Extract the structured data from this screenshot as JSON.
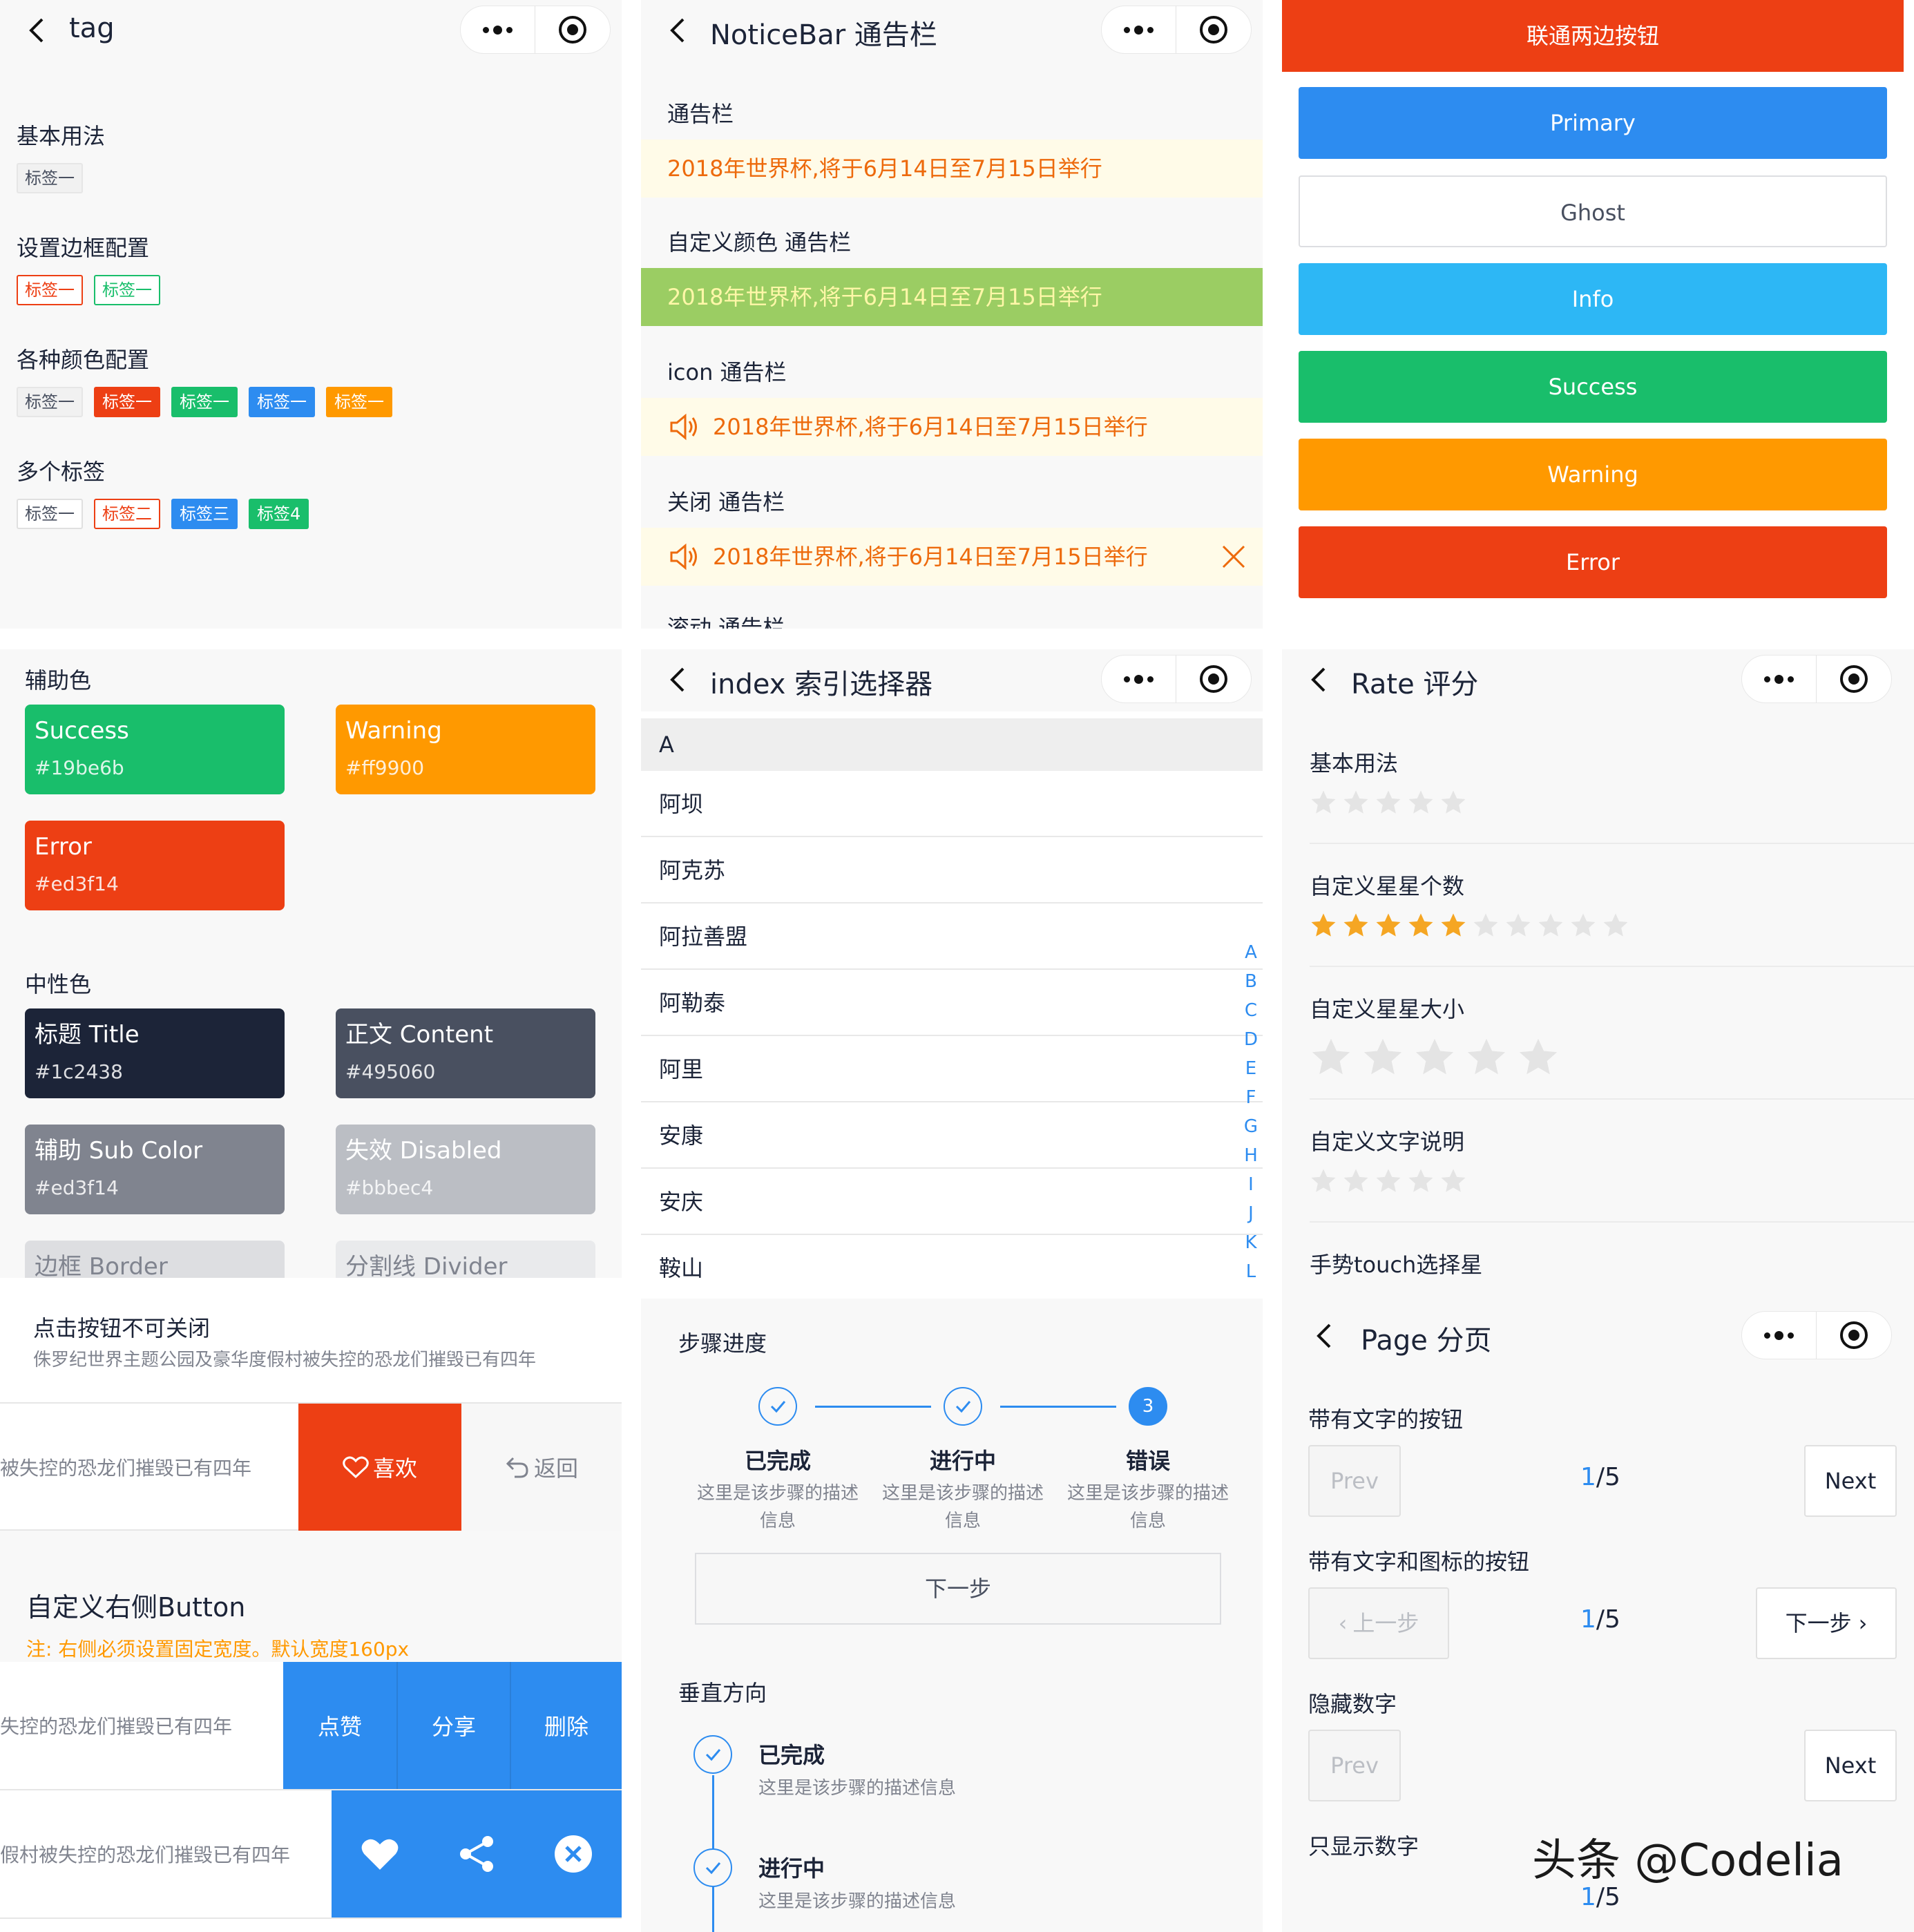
{
  "tag": {
    "title": "tag",
    "sections": [
      "基本用法",
      "设置边框配置",
      "各种颜色配置",
      "多个标签"
    ],
    "basic": [
      "标签一"
    ],
    "border": [
      "标签一",
      "标签一"
    ],
    "colors": [
      "标签一",
      "标签一",
      "标签一",
      "标签一",
      "标签一"
    ],
    "multi": [
      "标签一",
      "标签二",
      "标签三",
      "标签4"
    ]
  },
  "notice": {
    "title": "NoticeBar 通告栏",
    "sections": [
      "通告栏",
      "自定义颜色 通告栏",
      "icon 通告栏",
      "关闭 通告栏",
      "滚动 通告栏"
    ],
    "text": "2018年世界杯,将于6月14日至7月15日举行"
  },
  "buttons": {
    "top": "联通两边按钮",
    "items": [
      "Primary",
      "Ghost",
      "Info",
      "Success",
      "Warning",
      "Error"
    ],
    "colors": [
      "#2d8cf0",
      "#ffffff",
      "#2db7f5",
      "#19be6b",
      "#ff9900",
      "#ed3f14"
    ]
  },
  "colors": {
    "aux_title": "辅助色",
    "neutral_title": "中性色",
    "aux": [
      {
        "name": "Success",
        "code": "#19be6b"
      },
      {
        "name": "Warning",
        "code": "#ff9900"
      },
      {
        "name": "Error",
        "code": "#ed3f14"
      }
    ],
    "neutral": [
      {
        "name": "标题 Title",
        "code": "#1c2438"
      },
      {
        "name": "正文 Content",
        "code": "#495060"
      },
      {
        "name": "辅助 Sub Color",
        "code": "#ed3f14"
      },
      {
        "name": "失效 Disabled",
        "code": "#bbbec4"
      },
      {
        "name": "边框 Border",
        "code": ""
      },
      {
        "name": "分割线 Divider",
        "code": ""
      }
    ]
  },
  "index": {
    "title": "index 索引选择器",
    "header": "A",
    "rows": [
      "阿坝",
      "阿克苏",
      "阿拉善盟",
      "阿勒泰",
      "阿里",
      "安康",
      "安庆",
      "鞍山"
    ],
    "letters": [
      "A",
      "B",
      "C",
      "D",
      "E",
      "F",
      "G",
      "H",
      "I",
      "J",
      "K",
      "L"
    ]
  },
  "rate": {
    "title": "Rate 评分",
    "sections": [
      "基本用法",
      "自定义星星个数",
      "自定义星星大小",
      "自定义文字说明",
      "手势touch选择星"
    ],
    "basic_total": 5,
    "basic_value": 0,
    "custom_total": 10,
    "custom_value": 5,
    "size_total": 5,
    "size_value": 0,
    "text_total": 5,
    "text_value": 0
  },
  "swipe": {
    "row1_title": "点击按钮不可关闭",
    "row1_desc": "侏罗纪世界主题公园及豪华度假村被失控的恐龙们摧毁已有四年",
    "row2_text": "被失控的恐龙们摧毁已有四年",
    "like": "喜欢",
    "back": "返回",
    "custom_title": "自定义右侧Button",
    "custom_note": "注: 右侧必须设置固定宽度。默认宽度160px",
    "row3_text": "失控的恐龙们摧毁已有四年",
    "actions": [
      "点赞",
      "分享",
      "删除"
    ],
    "row4_text": "假村被失控的恐龙们摧毁已有四年"
  },
  "steps": {
    "title": "步骤进度",
    "items": [
      {
        "name": "已完成",
        "desc": "这里是该步骤的描述信息"
      },
      {
        "name": "进行中",
        "desc": "这里是该步骤的描述信息"
      },
      {
        "name": "错误",
        "desc": "这里是该步骤的描述信息"
      }
    ],
    "step3_num": "3",
    "next": "下一步",
    "vertical_title": "垂直方向",
    "vertical": [
      {
        "name": "已完成",
        "desc": "这里是该步骤的描述信息"
      },
      {
        "name": "进行中",
        "desc": "这里是该步骤的描述信息"
      }
    ]
  },
  "page": {
    "title": "Page 分页",
    "sections": [
      "带有文字的按钮",
      "带有文字和图标的按钮",
      "隐藏数字",
      "只显示数字"
    ],
    "prev": "Prev",
    "next": "Next",
    "prev_cn": "上一步",
    "next_cn": "下一步",
    "current": "1",
    "total": "/5"
  },
  "watermark": "头条 @Codelia"
}
